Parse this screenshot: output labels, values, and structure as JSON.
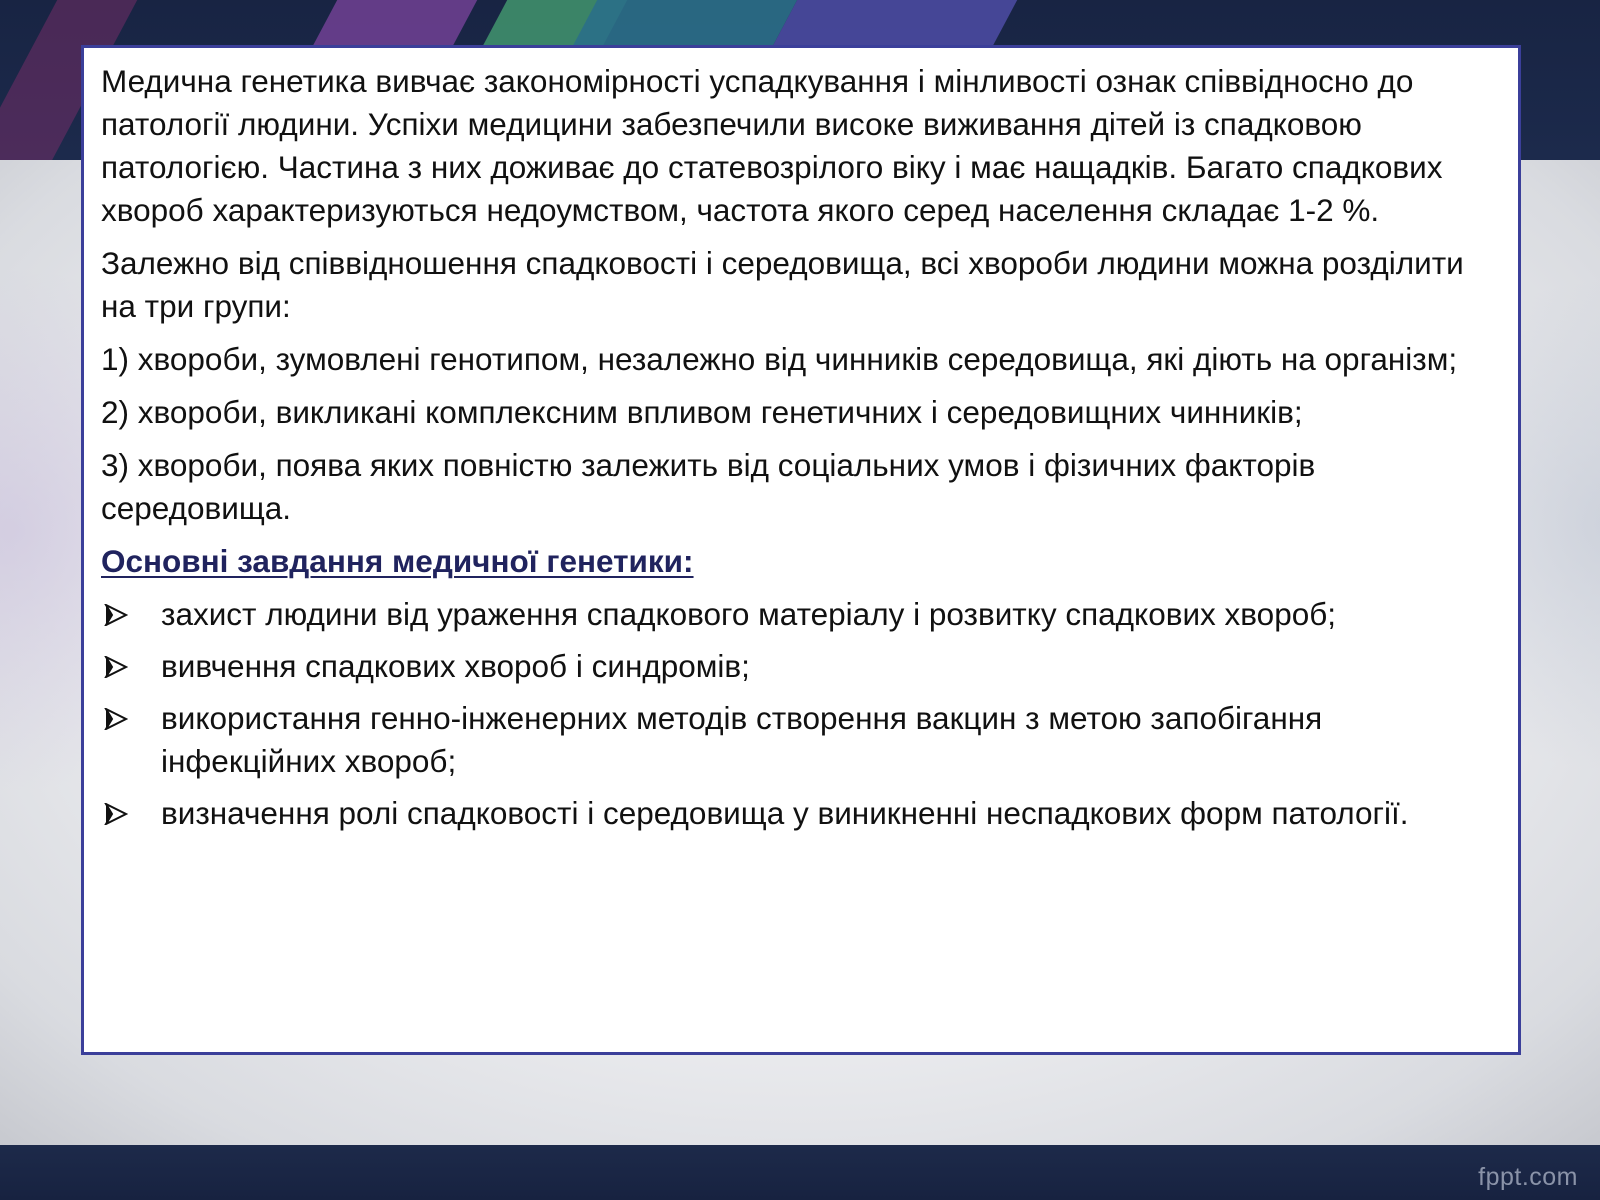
{
  "slide": {
    "paragraphs": [
      "Медична генетика вивчає закономірності успадкування і мінливості ознак співвідносно до патології людини. Успіхи медицини забезпечили високе виживання дітей із спадковою патологією. Частина з них доживає до статевозрілого віку і має нащадків. Багато спадкових хвороб характеризуються недоумством, частота якого серед населення складає 1-2 %.",
      "Залежно від співвідношення спадковості і середовища, всі хвороби людини можна розділити на три групи:",
      "1) хвороби, зумовлені генотипом, незалежно від чинників середовища, які діють на організм;",
      "2) хвороби, викликані комплексним впливом генетичних і середовищних чинників;",
      "3) хвороби, поява яких повністю залежить від соціальних умов і фізичних факторів середовища."
    ],
    "tasks_heading": "Основні завдання медичної генетики:",
    "tasks": [
      "захист людини від ураження спадкового матеріалу і розвитку спадкових хвороб;",
      "вивчення спадкових хвороб і синдромів;",
      "використання генно-інженерних методів створення вакцин з метою запобігання інфекційних хвороб;",
      "визначення ролі спадковості і середовища у виникненні неспадкових форм патології."
    ],
    "bullet_icon": "arrowhead-bullet-icon"
  },
  "footer": {
    "brand": "fppt.com"
  },
  "colors": {
    "heading": "#20235e",
    "box_border": "#3b3f9a",
    "background_dark": "#1a2747"
  }
}
